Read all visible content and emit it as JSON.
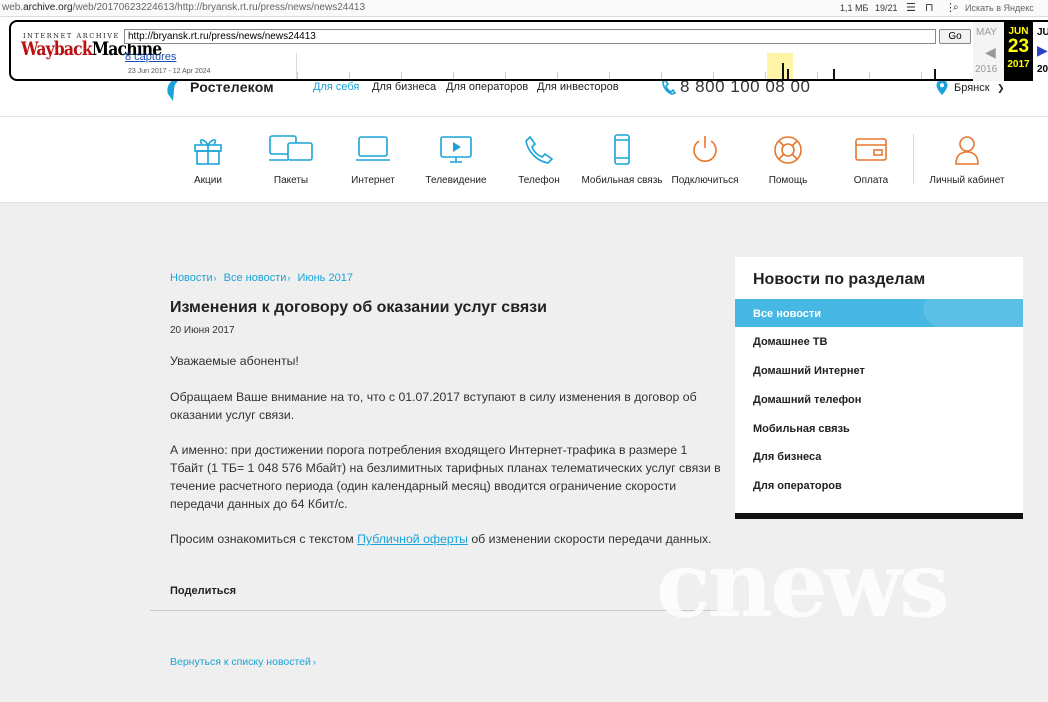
{
  "browser": {
    "url_prefix": "web.",
    "url_host": "archive.org",
    "url_rest": "/web/20170623224613/http://bryansk.rt.ru/press/news/news24413",
    "size": "1,1 МБ",
    "counter": "19/21",
    "search_placeholder": "Искать в Яндекс"
  },
  "wayback": {
    "logo_top": "INTERNET ARCHIVE",
    "logo_a": "Wayback",
    "logo_b": "Machine",
    "url": "http://bryansk.rt.ru/press/news/news24413",
    "go": "Go",
    "captures": "8 captures",
    "range": "23 Jun 2017 - 12 Apr 2024",
    "prev_month": "MAY",
    "prev_year": "2016",
    "cur_month": "JUN",
    "cur_day": "23",
    "cur_year": "2017",
    "next_month": "JU",
    "next_year": "20"
  },
  "header": {
    "logo": "Ростелеком",
    "links": [
      "Для себя",
      "Для бизнеса",
      "Для операторов",
      "Для инвесторов"
    ],
    "phone": "8 800 100 08 00",
    "city": "Брянск"
  },
  "nav": [
    {
      "label": "Акции"
    },
    {
      "label": "Пакеты"
    },
    {
      "label": "Интернет"
    },
    {
      "label": "Телевидение"
    },
    {
      "label": "Телефон"
    },
    {
      "label": "Мобильная связь"
    },
    {
      "label": "Подключиться"
    },
    {
      "label": "Помощь"
    },
    {
      "label": "Оплата"
    },
    {
      "label": "Личный кабинет"
    }
  ],
  "article": {
    "crumbs": [
      "Новости",
      "Все новости",
      "Июнь 2017"
    ],
    "title": "Изменения к договору об оказании услуг связи",
    "date": "20 Июня 2017",
    "p1": "Уважаемые абоненты!",
    "p2": "Обращаем Ваше внимание на то, что с 01.07.2017 вступают в силу изменения в договор об оказании услуг связи.",
    "p3": "А именно: при достижении порога потребления входящего Интернет-трафика в размере 1 Тбайт (1 ТБ= 1 048 576 Мбайт) на безлимитных тарифных планах телематических услуг связи в течение расчетного периода (один календарный месяц) вводится ограничение скорости передачи данных до 64 Кбит/с.",
    "p4_before": "Просим ознакомиться с текстом ",
    "p4_link": "Публичной оферты",
    "p4_after": " об изменении скорости передачи данных.",
    "share": "Поделиться",
    "back": "Вернуться к списку новостей"
  },
  "sidebar": {
    "title": "Новости по разделам",
    "active": "Все новости",
    "items": [
      "Домашнее ТВ",
      "Домашний Интернет",
      "Домашний телефон",
      "Мобильная связь",
      "Для бизнеса",
      "Для операторов"
    ]
  },
  "watermark": "cnews",
  "colors": {
    "accent": "#1aa3d8",
    "nav_icon": "#1aa3d8",
    "nav_icon_orange": "#e8772e",
    "active_bg": "#46b8e3"
  }
}
